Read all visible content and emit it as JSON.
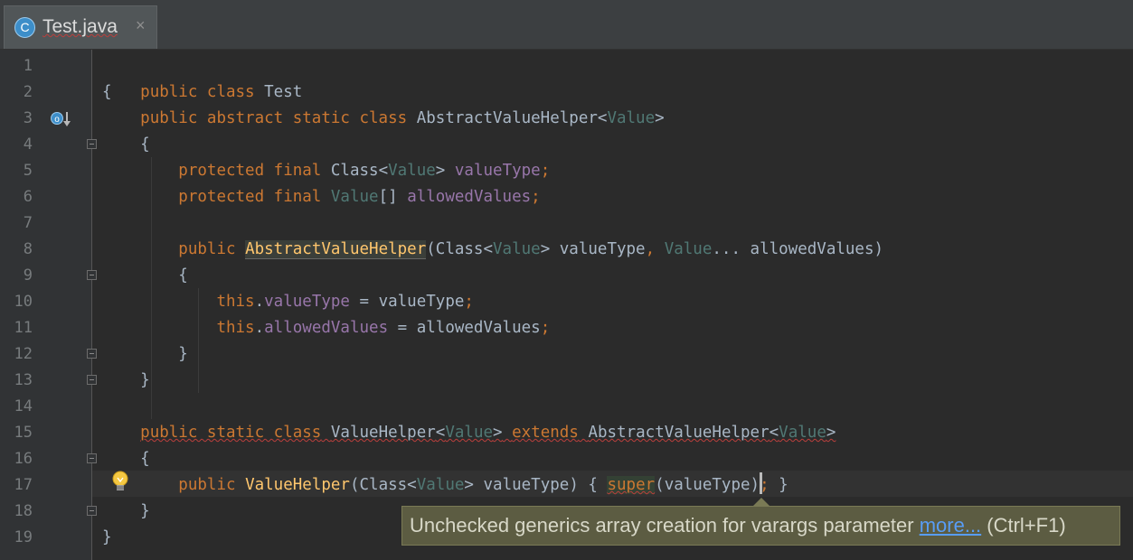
{
  "tab": {
    "icon_letter": "C",
    "label": "Test.java",
    "close": "×"
  },
  "line_numbers": [
    "1",
    "2",
    "3",
    "4",
    "5",
    "6",
    "7",
    "8",
    "9",
    "10",
    "11",
    "12",
    "13",
    "14",
    "15",
    "16",
    "17",
    "18",
    "19"
  ],
  "code": {
    "l1": {
      "kw1": "public class",
      "name": "Test"
    },
    "l2": {
      "brace": "{"
    },
    "l3": {
      "kw": "public abstract static class",
      "name": "AbstractValueHelper",
      "lt": "<",
      "tp": "Value",
      "gt": ">"
    },
    "l4": {
      "brace": "{"
    },
    "l5": {
      "kw": "protected final",
      "t1": "Class<",
      "tp": "Value",
      "t2": ">",
      "field": "valueType",
      "semi": ";"
    },
    "l6": {
      "kw": "protected final",
      "tp": "Value",
      "t1": "[]",
      "field": "allowedValues",
      "semi": ";"
    },
    "l8": {
      "kw": "public",
      "name": "AbstractValueHelper",
      "p1": "(Class<",
      "tp1": "Value",
      "p2": "> valueType",
      "comma": ",",
      "tp2": "Value",
      "p3": "... allowedValues)"
    },
    "l9": {
      "brace": "{"
    },
    "l10": {
      "kw": "this",
      "dot": ".",
      "field": "valueType",
      "rest": " = valueType",
      "semi": ";"
    },
    "l11": {
      "kw": "this",
      "dot": ".",
      "field": "allowedValues",
      "rest": " = allowedValues",
      "semi": ";"
    },
    "l12": {
      "brace": "}"
    },
    "l13": {
      "brace": "}"
    },
    "l15": {
      "kw1": "public static class",
      "name": "ValueHelper",
      "lt": "<",
      "tp": "Value",
      "gt": ">",
      "kw2": "extends",
      "name2": "AbstractValueHelper",
      "lt2": "<",
      "tp2": "Value",
      "gt2": ">"
    },
    "l16": {
      "brace": "{"
    },
    "l17": {
      "kw": "public",
      "name": "ValueHelper",
      "p1": "(Class<",
      "tp": "Value",
      "p2": "> valueType) { ",
      "sup": "super",
      "p3": "(valueType)",
      "semi": ";",
      "p4": " }"
    },
    "l18": {
      "brace": "}"
    },
    "l19": {
      "brace": "}"
    }
  },
  "tooltip": {
    "message": "Unchecked generics array creation for varargs parameter ",
    "link": "more...",
    "shortcut": " (Ctrl+F1)"
  },
  "colors": {
    "keyword": "#cc7832",
    "type_param": "#507874",
    "field": "#9876aa",
    "method": "#ffc66d",
    "plain": "#a9b7c6"
  }
}
